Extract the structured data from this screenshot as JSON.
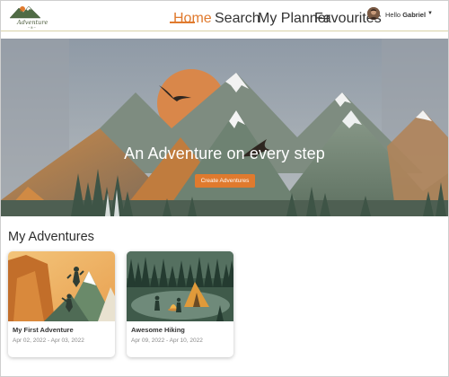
{
  "app": {
    "logo_text": "Adventure",
    "logo_sub": "~ it ~"
  },
  "nav": {
    "items": [
      {
        "label": "Home",
        "active": true
      },
      {
        "label": "Search",
        "active": false
      },
      {
        "label": "My Planner",
        "active": false
      },
      {
        "label": "Favourites",
        "active": false
      }
    ],
    "greeting": "Hello",
    "user_name": "Gabriel",
    "accent_color": "#e07a2e"
  },
  "hero": {
    "title": "An Adventure on every step",
    "button_label": "Create Adventures"
  },
  "adventures": {
    "section_title": "My Adventures",
    "cards": [
      {
        "title": "My First Adventure",
        "dates": "Apr 02, 2022 - Apr 03, 2022",
        "image": "climbers-illustration"
      },
      {
        "title": "Awesome Hiking",
        "dates": "Apr 09, 2022 - Apr 10, 2022",
        "image": "camping-illustration"
      }
    ]
  }
}
